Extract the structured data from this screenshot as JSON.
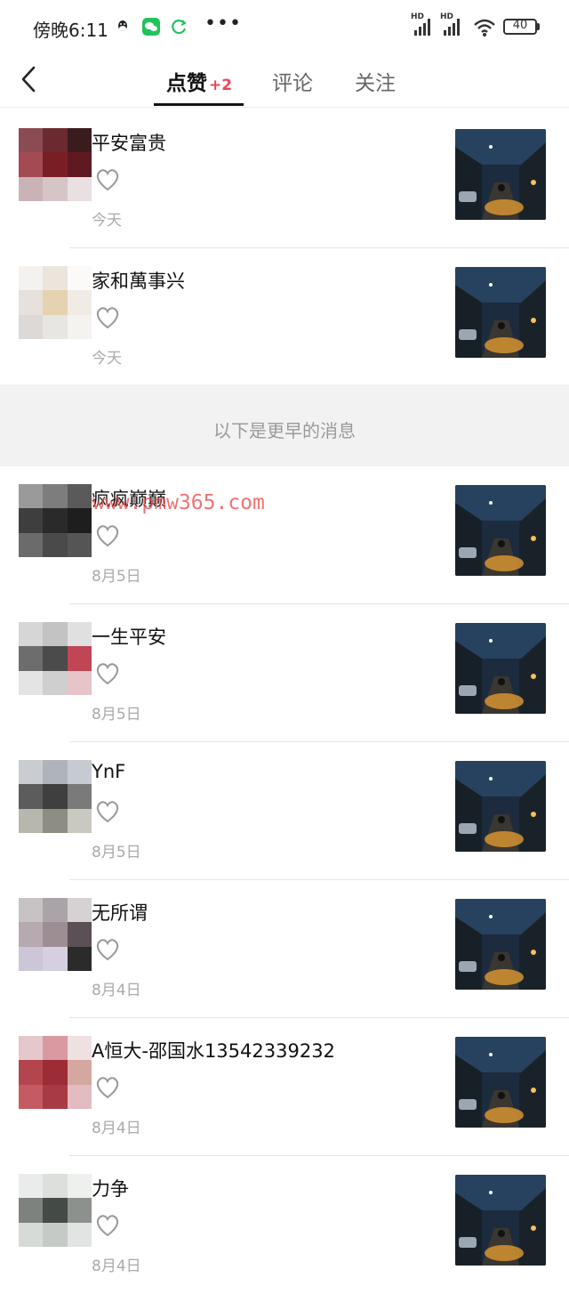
{
  "status_bar": {
    "time": "傍晚6:11",
    "battery": "40",
    "network": [
      "HD",
      "HD"
    ]
  },
  "tabs": {
    "likes_label": "点赞",
    "likes_badge": "+2",
    "comments_label": "评论",
    "follow_label": "关注"
  },
  "separator_text": "以下是更早的消息",
  "watermark_text": "www.pmw365.com",
  "colors": {
    "badge": "#ee4455",
    "accent": "#111111",
    "separator_bg": "#f2f2f2"
  },
  "items": [
    {
      "name": "平安富贵",
      "time": "今天"
    },
    {
      "name": "家和萬事兴",
      "time": "今天"
    },
    {
      "name": "疯疯巅巅",
      "time": "8月5日"
    },
    {
      "name": "一生平安",
      "time": "8月5日"
    },
    {
      "name": "YnF",
      "time": "8月5日"
    },
    {
      "name": "无所谓",
      "time": "8月4日"
    },
    {
      "name": "A恒大-邵国水13542339232",
      "time": "8月4日"
    },
    {
      "name": "力争",
      "time": "8月4日"
    }
  ]
}
